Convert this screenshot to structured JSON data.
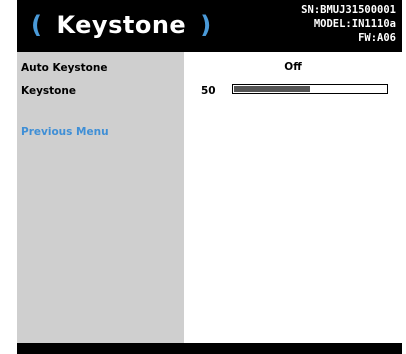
{
  "header": {
    "open_paren": "(",
    "title": "Keystone",
    "close_paren": ")",
    "serial": "SN:BMUJ31500001",
    "model": "MODEL:IN1110a",
    "firmware": "FW:A06"
  },
  "menu": {
    "items": [
      {
        "label": "Auto Keystone",
        "value": "Off"
      },
      {
        "label": "Keystone",
        "value": "50",
        "level_percent": 50
      },
      {
        "label": "Previous Menu"
      }
    ]
  },
  "colors": {
    "accent": "#4a9ad8",
    "link": "#3f8fd6",
    "left_panel": "#cfcfcf",
    "slider_fill": "#555555"
  }
}
